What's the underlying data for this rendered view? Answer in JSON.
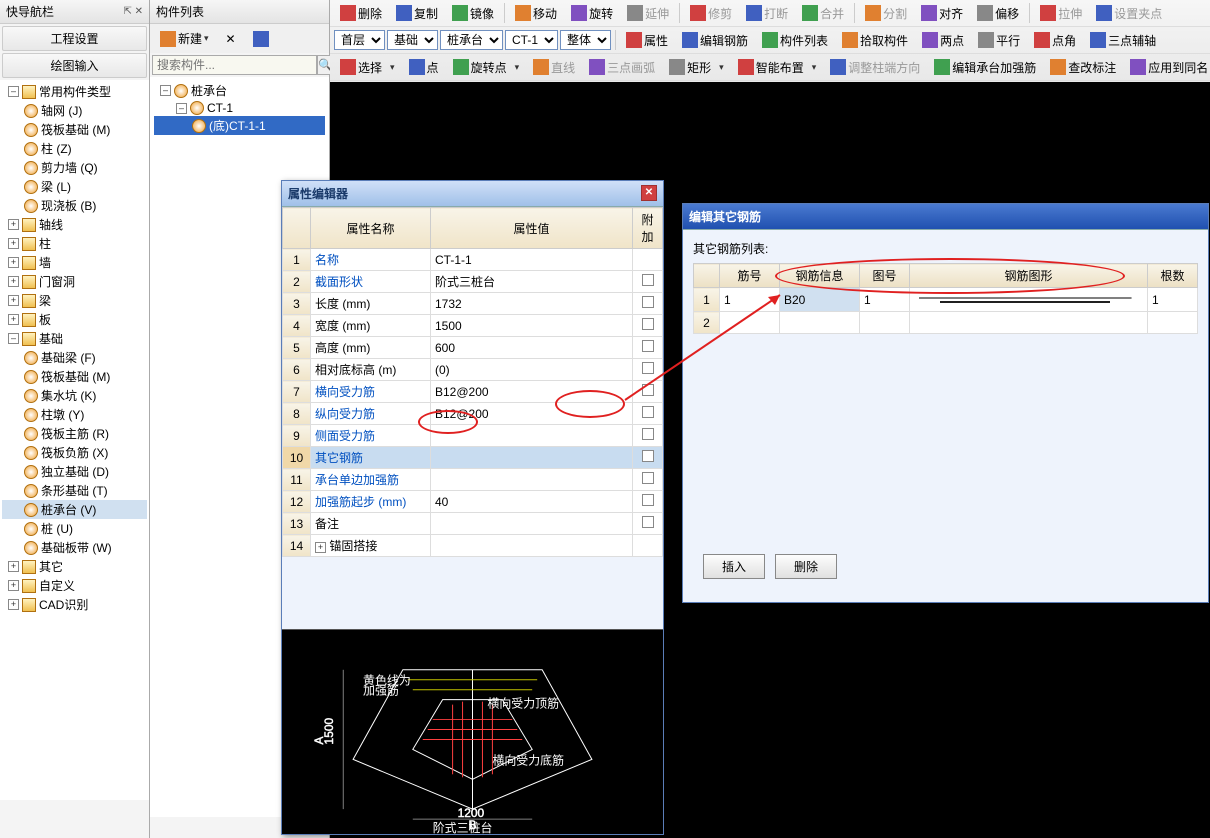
{
  "nav": {
    "title": "快导航栏",
    "pin": "⇱ ✕",
    "sec1": "工程设置",
    "sec2": "绘图输入",
    "tree": [
      {
        "lv": 1,
        "exp": "–",
        "ico": "folder",
        "label": "常用构件类型"
      },
      {
        "lv": 2,
        "ico": "g",
        "label": "轴网 (J)"
      },
      {
        "lv": 2,
        "ico": "g",
        "label": "筏板基础 (M)"
      },
      {
        "lv": 2,
        "ico": "g",
        "label": "柱 (Z)"
      },
      {
        "lv": 2,
        "ico": "g",
        "label": "剪力墙 (Q)"
      },
      {
        "lv": 2,
        "ico": "g",
        "label": "梁 (L)"
      },
      {
        "lv": 2,
        "ico": "g",
        "label": "现浇板 (B)"
      },
      {
        "lv": 1,
        "exp": "+",
        "ico": "folder",
        "label": "轴线"
      },
      {
        "lv": 1,
        "exp": "+",
        "ico": "folder",
        "label": "柱"
      },
      {
        "lv": 1,
        "exp": "+",
        "ico": "folder",
        "label": "墙"
      },
      {
        "lv": 1,
        "exp": "+",
        "ico": "folder",
        "label": "门窗洞"
      },
      {
        "lv": 1,
        "exp": "+",
        "ico": "folder",
        "label": "梁"
      },
      {
        "lv": 1,
        "exp": "+",
        "ico": "folder",
        "label": "板"
      },
      {
        "lv": 1,
        "exp": "–",
        "ico": "folder",
        "label": "基础"
      },
      {
        "lv": 2,
        "ico": "g",
        "label": "基础梁 (F)"
      },
      {
        "lv": 2,
        "ico": "g",
        "label": "筏板基础 (M)"
      },
      {
        "lv": 2,
        "ico": "g",
        "label": "集水坑 (K)"
      },
      {
        "lv": 2,
        "ico": "g",
        "label": "柱墩 (Y)"
      },
      {
        "lv": 2,
        "ico": "g",
        "label": "筏板主筋 (R)"
      },
      {
        "lv": 2,
        "ico": "g",
        "label": "筏板负筋 (X)"
      },
      {
        "lv": 2,
        "ico": "g",
        "label": "独立基础 (D)"
      },
      {
        "lv": 2,
        "ico": "g",
        "label": "条形基础 (T)"
      },
      {
        "lv": 2,
        "ico": "g",
        "label": "桩承台 (V)",
        "sel": true
      },
      {
        "lv": 2,
        "ico": "g",
        "label": "桩 (U)"
      },
      {
        "lv": 2,
        "ico": "g",
        "label": "基础板带 (W)"
      },
      {
        "lv": 1,
        "exp": "+",
        "ico": "folder",
        "label": "其它"
      },
      {
        "lv": 1,
        "exp": "+",
        "ico": "folder",
        "label": "自定义"
      },
      {
        "lv": 1,
        "exp": "+",
        "ico": "folder",
        "label": "CAD识别"
      }
    ]
  },
  "comp": {
    "title": "构件列表",
    "new": "新建",
    "search_placeholder": "搜索构件...",
    "tree": [
      {
        "lv": 1,
        "exp": "–",
        "ico": "gear",
        "label": "桩承台"
      },
      {
        "lv": 2,
        "exp": "–",
        "ico": "gear",
        "label": "CT-1"
      },
      {
        "lv": 3,
        "ico": "gear",
        "label": "(底)CT-1-1",
        "sel": true
      }
    ]
  },
  "toolbar": {
    "r1": [
      "删除",
      "复制",
      "镜像",
      "移动",
      "旋转",
      "延伸",
      "修剪",
      "打断",
      "合并",
      "分割",
      "对齐",
      "偏移",
      "拉伸",
      "设置夹点"
    ],
    "r2_sels": [
      "首层",
      "基础",
      "桩承台",
      "CT-1",
      "整体"
    ],
    "r2_btns": [
      "属性",
      "编辑钢筋",
      "构件列表",
      "拾取构件",
      "两点",
      "平行",
      "点角",
      "三点辅轴"
    ],
    "r3": [
      "选择",
      "点",
      "旋转点",
      "直线",
      "三点画弧",
      "矩形",
      "智能布置",
      "调整柱端方向",
      "编辑承台加强筋",
      "查改标注",
      "应用到同名"
    ]
  },
  "prop": {
    "title": "属性编辑器",
    "headers": [
      "属性名称",
      "属性值",
      "附加"
    ],
    "rows": [
      {
        "n": "1",
        "name": "名称",
        "val": "CT-1-1",
        "link": true
      },
      {
        "n": "2",
        "name": "截面形状",
        "val": "阶式三桩台",
        "link": true
      },
      {
        "n": "3",
        "name": "长度 (mm)",
        "val": "1732"
      },
      {
        "n": "4",
        "name": "宽度 (mm)",
        "val": "1500"
      },
      {
        "n": "5",
        "name": "高度 (mm)",
        "val": "600"
      },
      {
        "n": "6",
        "name": "相对底标高 (m)",
        "val": "(0)"
      },
      {
        "n": "7",
        "name": "横向受力筋",
        "val": "B12@200",
        "link": true
      },
      {
        "n": "8",
        "name": "纵向受力筋",
        "val": "B12@200",
        "link": true
      },
      {
        "n": "9",
        "name": "侧面受力筋",
        "val": "",
        "link": true
      },
      {
        "n": "10",
        "name": "其它钢筋",
        "val": "",
        "link": true,
        "hl": true
      },
      {
        "n": "11",
        "name": "承台单边加强筋",
        "val": "",
        "link": true
      },
      {
        "n": "12",
        "name": "加强筋起步 (mm)",
        "val": "40",
        "link": true
      },
      {
        "n": "13",
        "name": "备注",
        "val": ""
      },
      {
        "n": "14",
        "name": "锚固搭接",
        "val": "",
        "exp": "+"
      }
    ],
    "preview_label1": "黄色线为\n加强筋",
    "preview_label2": "横向受力顶筋",
    "preview_label3": "横向受力底筋",
    "preview_dim1": "1500",
    "preview_dim2": "1200",
    "preview_title": "阶式三桩台"
  },
  "rebar": {
    "title": "编辑其它钢筋",
    "list_label": "其它钢筋列表:",
    "headers": [
      "筋号",
      "钢筋信息",
      "图号",
      "钢筋图形",
      "根数"
    ],
    "rows": [
      {
        "n": "1",
        "num": "1",
        "info": "B20",
        "img": "1",
        "shape": "",
        "count": "1"
      },
      {
        "n": "2",
        "num": "",
        "info": "",
        "img": "",
        "shape": "",
        "count": ""
      }
    ],
    "btn_insert": "插入",
    "btn_delete": "删除"
  }
}
